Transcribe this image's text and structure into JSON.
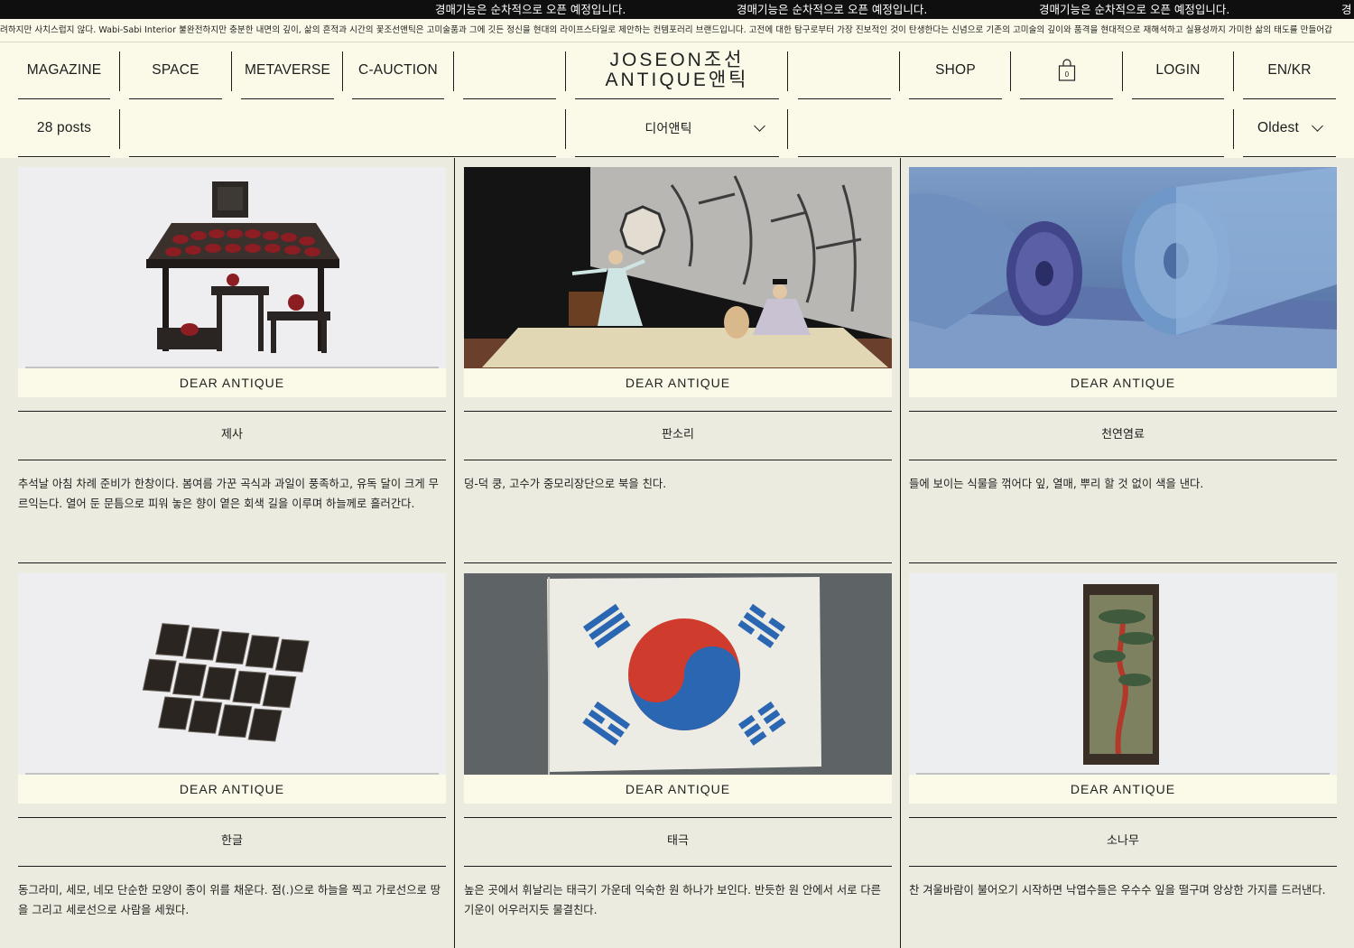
{
  "ticker": {
    "messages": [
      "경매기능은 순차적으로 오픈 예정입니다.",
      "경매기능은 순차적으로 오픈 예정입니다.",
      "경매기능은 순차적으로 오픈 예정입니다.",
      "경"
    ]
  },
  "strip": {
    "text": "려하지만 사치스럽지 않다. Wabi-Sabi Interior 불완전하지만 충분한 내면의 깊이, 삶의 흔적과 시간의 꽃조선앤틱은 고미술품과 그에 깃든 정신을 현대의 라이프스타일로 제안하는 컨템포러리 브랜드입니다. 고전에 대한 탐구로부터 가장 진보적인 것이 탄생한다는 신념으로 기존의 고미술의 깊이와 품격을 현대적으로 재해석하고 실용성까지 가미한 삶의 태도를 만들어갑"
  },
  "nav": {
    "magazine": "MAGAZINE",
    "space": "SPACE",
    "metaverse": "METAVERSE",
    "cauction": "C-AUCTION",
    "shop": "SHOP",
    "cart_count": "0",
    "login": "LOGIN",
    "lang": "EN/KR"
  },
  "logo": {
    "line1": "JOSEON조선",
    "line2": "ANTIQUE앤틱"
  },
  "filters": {
    "posts": "28 posts",
    "category": "디어앤틱",
    "sort": "Oldest"
  },
  "posts": [
    {
      "category": "DEAR ANTIQUE",
      "title": "제사",
      "desc": "추석날 아침 차례 준비가 한창이다. 봄여름 가꾼 곡식과 과일이 풍족하고, 유독 달이 크게 무르익는다. 열어 둔 문틈으로 피워 놓은 향이 옅은 회색 길을 이루며 하늘께로 흘러간다."
    },
    {
      "category": "DEAR ANTIQUE",
      "title": "판소리",
      "desc": "덩-덕 쿵, 고수가 중모리장단으로 북을 친다."
    },
    {
      "category": "DEAR ANTIQUE",
      "title": "천연염료",
      "desc": "들에 보이는 식물을 꺾어다 잎, 열매, 뿌리 할 것 없이 색을 낸다."
    },
    {
      "category": "DEAR ANTIQUE",
      "title": "한글",
      "desc": "동그라미, 세모, 네모 단순한 모양이 종이 위를 채운다. 점(.)으로 하늘을 찍고 가로선으로 땅을 그리고 세로선으로 사람을 세웠다."
    },
    {
      "category": "DEAR ANTIQUE",
      "title": "태극",
      "desc": "높은 곳에서 휘날리는 태극기 가운데 익숙한 원 하나가 보인다. 반듯한 원 안에서 서로 다른 기운이 어우러지듯 물결친다."
    },
    {
      "category": "DEAR ANTIQUE",
      "title": "소나무",
      "desc": "찬 겨울바람이 불어오기 시작하면 낙엽수들은 우수수 잎을 떨구며 앙상한 가지를 드러낸다."
    }
  ],
  "colors": {
    "background": "#ecebdf",
    "header": "#fbf9e8",
    "ticker": "#0f0f0f"
  }
}
